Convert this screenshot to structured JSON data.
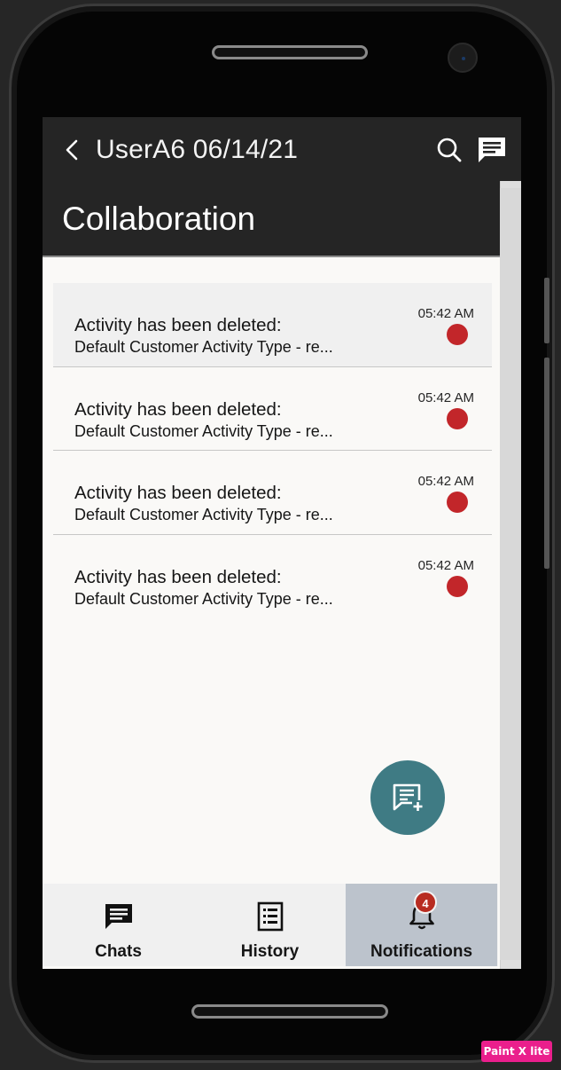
{
  "app": {
    "header_title": "UserA6 06/14/21",
    "page_title": "Collaboration"
  },
  "notifications": [
    {
      "title": "Activity has been deleted:",
      "subtitle": "Default Customer Activity Type - re...",
      "time": "05:42 AM",
      "unread": true
    },
    {
      "title": "Activity has been deleted:",
      "subtitle": "Default Customer Activity Type - re...",
      "time": "05:42 AM",
      "unread": true
    },
    {
      "title": "Activity has been deleted:",
      "subtitle": "Default Customer Activity Type - re...",
      "time": "05:42 AM",
      "unread": true
    },
    {
      "title": "Activity has been deleted:",
      "subtitle": "Default Customer Activity Type - re...",
      "time": "05:42 AM",
      "unread": true
    }
  ],
  "bottom_nav": {
    "chats_label": "Chats",
    "history_label": "History",
    "notifications_label": "Notifications",
    "notifications_badge": "4",
    "active_tab": "Notifications"
  },
  "colors": {
    "header_bg": "#252525",
    "unread_dot": "#c2262a",
    "fab_bg": "#3f7b84",
    "active_tab_bg": "#bcc3cc",
    "badge_bg": "#b82c21"
  },
  "watermark": "Paint X lite"
}
